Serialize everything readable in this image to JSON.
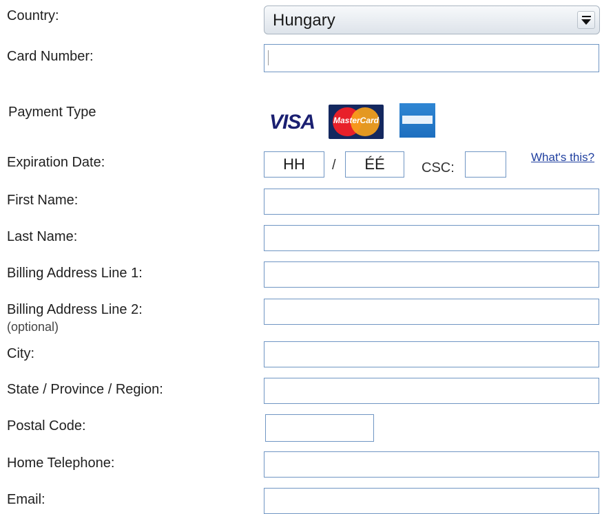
{
  "form": {
    "country": {
      "label": "Country:",
      "value": "Hungary"
    },
    "card_number": {
      "label": "Card Number:",
      "value": ""
    },
    "payment_type": {
      "label": "Payment Type",
      "logo_texts": {
        "visa": "VISA",
        "mastercard": "MasterCard"
      }
    },
    "expiration": {
      "label": "Expiration Date:",
      "month_placeholder": "HH",
      "separator": "/",
      "year_placeholder": "ÉÉ",
      "csc_label": "CSC:",
      "whats_this": "What's this?"
    },
    "first_name": {
      "label": "First Name:",
      "value": ""
    },
    "last_name": {
      "label": "Last Name:",
      "value": ""
    },
    "billing_1": {
      "label": "Billing Address Line 1:",
      "value": ""
    },
    "billing_2": {
      "label": "Billing Address Line 2:",
      "sublabel": "(optional)",
      "value": ""
    },
    "city": {
      "label": "City:",
      "value": ""
    },
    "state": {
      "label": "State / Province / Region:",
      "value": ""
    },
    "postal": {
      "label": "Postal Code:",
      "value": ""
    },
    "phone": {
      "label": "Home Telephone:",
      "value": ""
    },
    "email": {
      "label": "Email:",
      "value": ""
    }
  },
  "colors": {
    "field_border": "#6f95c3",
    "link": "#1f3f9f",
    "visa_blue": "#1a1f71",
    "mastercard_red": "#e8202a",
    "mastercard_orange": "#f6a21c",
    "amex_blue": "#1e6fbf"
  }
}
